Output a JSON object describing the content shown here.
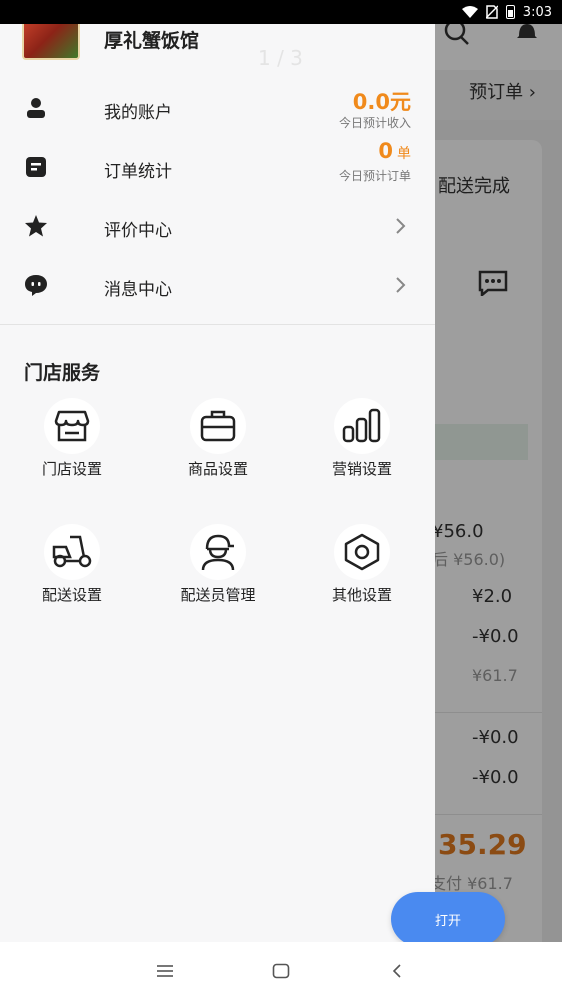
{
  "status_bar": {
    "time": "3:03"
  },
  "background": {
    "order_link": "预订单",
    "tab_label": "配送完成",
    "price_main": "¥56.0",
    "price_sub": "后 ¥56.0)",
    "rows": [
      "¥2.0",
      "-¥0.0",
      "¥61.7",
      "-¥0.0",
      "-¥0.0"
    ],
    "total": "35.29",
    "paid": "支付 ¥61.7"
  },
  "drawer": {
    "store_name": "厚礼蟹饭馆",
    "page_indicator": "1 / 3",
    "menu": [
      {
        "label": "我的账户",
        "icon": "person-icon"
      },
      {
        "label": "订单统计",
        "icon": "orders-icon"
      },
      {
        "label": "评价中心",
        "icon": "star-icon"
      },
      {
        "label": "消息中心",
        "icon": "chat-bubble-icon"
      }
    ],
    "stats": {
      "income_value": "0.0元",
      "income_caption": "今日预计收入",
      "orders_value": "0",
      "orders_unit": "单",
      "orders_caption": "今日预计订单"
    },
    "section_title": "门店服务",
    "services": [
      {
        "label": "门店设置",
        "icon": "storefront-icon"
      },
      {
        "label": "商品设置",
        "icon": "package-icon"
      },
      {
        "label": "营销设置",
        "icon": "bar-chart-icon"
      },
      {
        "label": "配送设置",
        "icon": "delivery-scooter-icon"
      },
      {
        "label": "配送员管理",
        "icon": "courier-icon"
      },
      {
        "label": "其他设置",
        "icon": "settings-hexagon-icon"
      }
    ]
  },
  "fab": {
    "label": "打开"
  },
  "colors": {
    "accent": "#f08a1c",
    "fab": "#4a8af0"
  }
}
